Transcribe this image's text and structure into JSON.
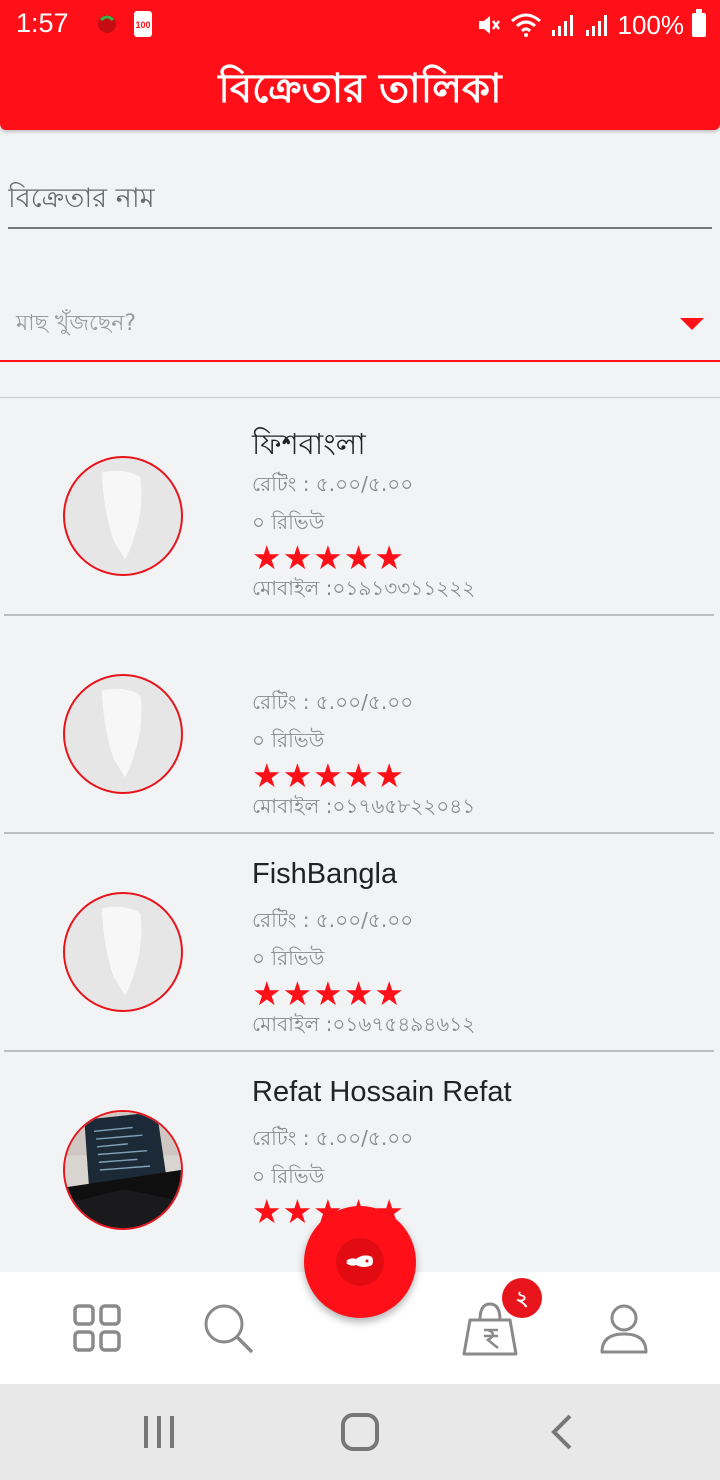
{
  "status_bar": {
    "time": "1:57",
    "battery_app_label": "100",
    "battery_percent": "100%"
  },
  "header": {
    "title": "বিক্রেতার তালিকা"
  },
  "search": {
    "seller_name_placeholder": "বিক্রেতার নাম",
    "fish_select_label": "মাছ খুঁজছেন?"
  },
  "sellers": [
    {
      "name": "ফিশবাংলা",
      "rating": "রেটিং : ৫.০০/৫.০০",
      "reviews": "০ রিভিউ",
      "stars": 5,
      "mobile": "মোবাইল :০১৯১৩৩১১২২২",
      "avatar": "fish-logo-icon"
    },
    {
      "name": "",
      "rating": "রেটিং : ৫.০০/৫.০০",
      "reviews": "০ রিভিউ",
      "stars": 5,
      "mobile": "মোবাইল :০১৭৬৫৮২২০৪১",
      "avatar": "fish-logo-icon"
    },
    {
      "name": "FishBangla",
      "rating": "রেটিং : ৫.০০/৫.০০",
      "reviews": "০ রিভিউ",
      "stars": 5,
      "mobile": "মোবাইল :০১৬৭৫৪৯৪৬১২",
      "avatar": "fish-logo-icon"
    },
    {
      "name": "Refat Hossain Refat",
      "rating": "রেটিং : ৫.০০/৫.০০",
      "reviews": "০ রিভিউ",
      "stars": 5,
      "mobile": "",
      "avatar": "laptop-photo"
    }
  ],
  "bottom_nav": {
    "items": [
      "grid-icon",
      "search-icon",
      "fish-icon",
      "shopping-bag-icon",
      "user-icon"
    ],
    "cart_badge": "২"
  },
  "colors": {
    "accent": "#ff0f17",
    "background": "#f2f3f5"
  }
}
